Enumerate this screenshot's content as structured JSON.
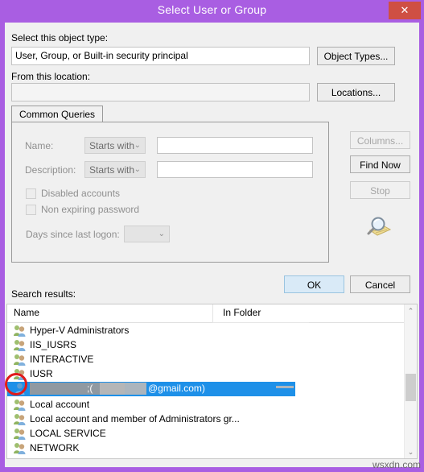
{
  "window": {
    "title": "Select User or Group",
    "close_label": "✕",
    "titlebar_color": "#a95ee2",
    "close_color": "#cf4f43"
  },
  "object_type": {
    "label": "Select this object type:",
    "value": "User, Group, or Built-in security principal",
    "button": "Object Types..."
  },
  "location": {
    "label": "From this location:",
    "value": "",
    "button": "Locations..."
  },
  "tabs": [
    {
      "label": "Common Queries",
      "active": true
    }
  ],
  "query": {
    "name_label": "Name:",
    "name_operator": "Starts with",
    "name_value": "",
    "description_label": "Description:",
    "description_operator": "Starts with",
    "description_value": "",
    "disabled_accounts_label": "Disabled accounts",
    "disabled_accounts_checked": false,
    "non_expiring_password_label": "Non expiring password",
    "non_expiring_password_checked": false,
    "days_since_logon_label": "Days since last logon:",
    "days_since_logon_value": "",
    "dropdown_arrow": "⌄"
  },
  "side_buttons": [
    {
      "label": "Columns...",
      "enabled": false
    },
    {
      "label": "Find Now",
      "enabled": true
    },
    {
      "label": "Stop",
      "enabled": false
    }
  ],
  "dialog_buttons": {
    "ok": "OK",
    "cancel": "Cancel"
  },
  "results": {
    "label": "Search results:",
    "columns": [
      "Name",
      "In Folder"
    ],
    "selection_color": "#1e90e8",
    "rows": [
      {
        "name": "Hyper-V Administrators",
        "folder": "",
        "icon": "group-icon",
        "selected": false
      },
      {
        "name": "IIS_IUSRS",
        "folder": "",
        "icon": "group-icon",
        "selected": false
      },
      {
        "name": "INTERACTIVE",
        "folder": "",
        "icon": "group-icon",
        "selected": false
      },
      {
        "name": "IUSR",
        "folder": "",
        "icon": "group-icon",
        "selected": false
      },
      {
        "name": "",
        "folder": "",
        "icon": "user-icon",
        "selected": true,
        "redacted": true,
        "visible_fragment_1": ";(",
        "visible_fragment_2": "@gmail.com)"
      },
      {
        "name": "Local account",
        "folder": "",
        "icon": "group-icon",
        "selected": false
      },
      {
        "name": "Local account and member of Administrators gr...",
        "folder": "",
        "icon": "group-icon",
        "selected": false
      },
      {
        "name": "LOCAL SERVICE",
        "folder": "",
        "icon": "group-icon",
        "selected": false
      },
      {
        "name": "NETWORK",
        "folder": "",
        "icon": "group-icon",
        "selected": false
      }
    ],
    "scrollbar": {
      "up_arrow": "⌃",
      "down_arrow": "⌄"
    }
  },
  "watermark": "wsxdn.com"
}
